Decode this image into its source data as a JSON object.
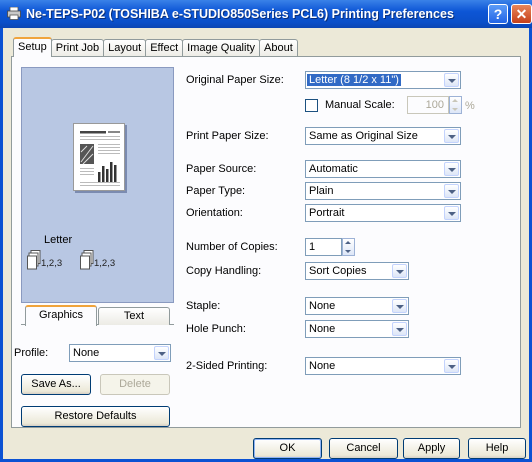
{
  "window": {
    "title": "Ne-TEPS-P02 (TOSHIBA e-STUDIO850Series PCL6) Printing Preferences",
    "help_button": "?",
    "close_button": "✕"
  },
  "tabs": [
    {
      "label": "Setup"
    },
    {
      "label": "Print Job"
    },
    {
      "label": "Layout"
    },
    {
      "label": "Effect"
    },
    {
      "label": "Image Quality"
    },
    {
      "label": "About"
    }
  ],
  "preview": {
    "paper_name": "Letter",
    "collate_label_1": "1,2,3",
    "collate_label_2": "1,2,3"
  },
  "subtabs": [
    {
      "label": "Graphics"
    },
    {
      "label": "Text"
    }
  ],
  "profile": {
    "label": "Profile:",
    "value": "None",
    "save_as": "Save As...",
    "delete": "Delete",
    "restore_defaults": "Restore Defaults"
  },
  "settings": {
    "original_paper_size": {
      "label": "Original Paper Size:",
      "value": "Letter (8 1/2 x 11\")"
    },
    "manual_scale": {
      "label": "Manual Scale:",
      "value": "100",
      "unit": "%"
    },
    "print_paper_size": {
      "label": "Print Paper Size:",
      "value": "Same as Original Size"
    },
    "paper_source": {
      "label": "Paper Source:",
      "value": "Automatic"
    },
    "paper_type": {
      "label": "Paper Type:",
      "value": "Plain"
    },
    "orientation": {
      "label": "Orientation:",
      "value": "Portrait"
    },
    "copies": {
      "label": "Number of Copies:",
      "value": "1"
    },
    "copy_handling": {
      "label": "Copy Handling:",
      "value": "Sort Copies"
    },
    "staple": {
      "label": "Staple:",
      "value": "None"
    },
    "hole_punch": {
      "label": "Hole Punch:",
      "value": "None"
    },
    "two_sided": {
      "label": "2-Sided Printing:",
      "value": "None"
    }
  },
  "buttons": {
    "ok": "OK",
    "cancel": "Cancel",
    "apply": "Apply",
    "help": "Help"
  }
}
